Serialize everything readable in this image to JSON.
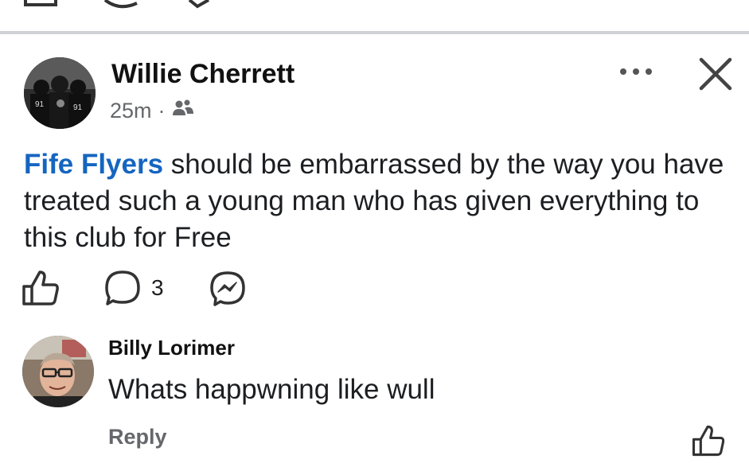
{
  "post": {
    "author": "Willie Cherrett",
    "time": "25m",
    "separator": "·",
    "audience_icon": "friends-icon",
    "mention": "Fife Flyers",
    "text": " should be embarrassed by the way you have treated such a young man who has given everything to this club for Free",
    "comment_count": "3"
  },
  "reply": {
    "author": "Billy Lorimer",
    "text": "Whats happwning like wull",
    "reply_label": "Reply"
  },
  "colors": {
    "mention": "#1565c0",
    "secondary_text": "#65676b",
    "divider": "#cfd1d4"
  }
}
